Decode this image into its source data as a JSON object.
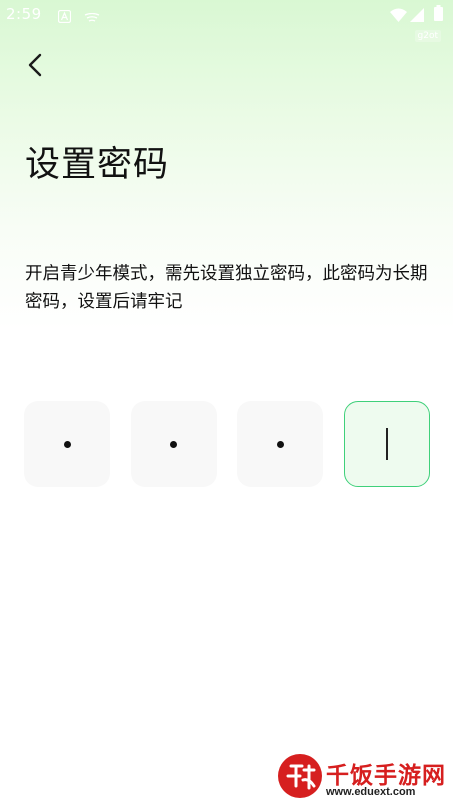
{
  "status_bar": {
    "time": "2:59",
    "icons": [
      "notification-a-icon",
      "cast-icon",
      "wifi-icon",
      "signal-icon",
      "battery-icon"
    ],
    "tag": "g2ot"
  },
  "header": {
    "back_icon": "chevron-left-icon"
  },
  "page": {
    "title": "设置密码",
    "description": "开启青少年模式，需先设置独立密码，此密码为长期密码，设置后请牢记"
  },
  "pin": {
    "length": 4,
    "filled": 3,
    "active_index": 3
  },
  "watermark": {
    "brand": "千饭手游网",
    "url": "www.eduext.com"
  },
  "colors": {
    "accent": "#3fd07a",
    "watermark_red": "#d61f1f",
    "box_bg": "#f8f8f8"
  }
}
